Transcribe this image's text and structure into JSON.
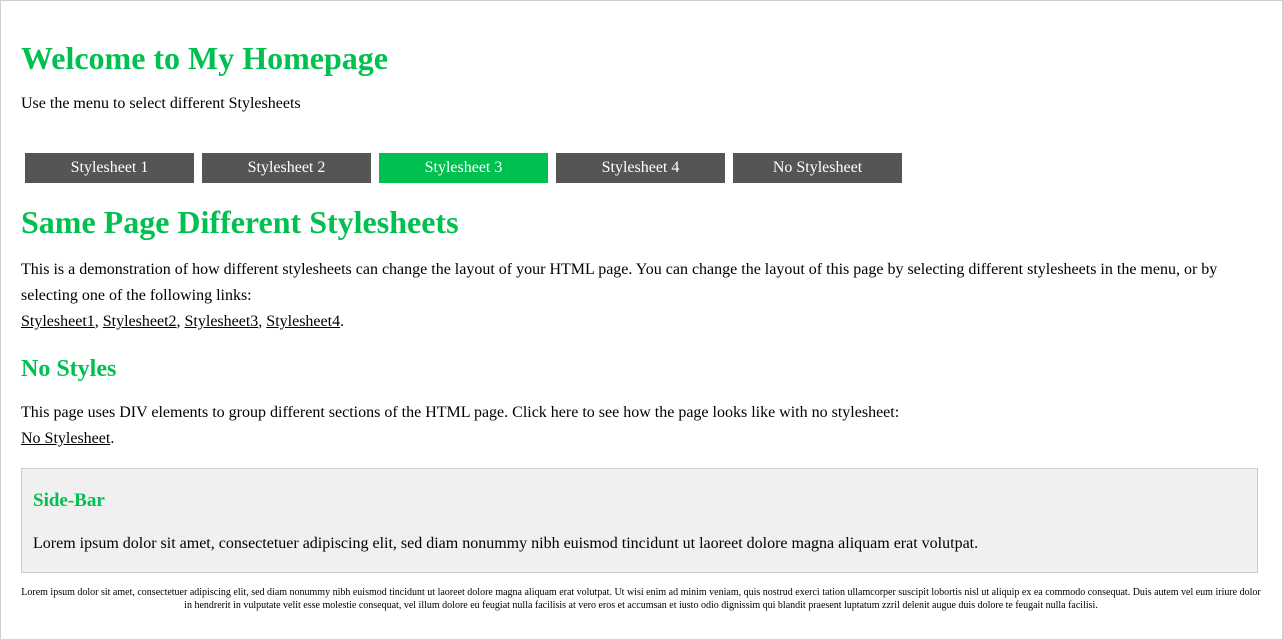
{
  "header": {
    "title": "Welcome to My Homepage",
    "subtitle": "Use the menu to select different Stylesheets"
  },
  "menu": {
    "items": [
      {
        "label": "Stylesheet 1"
      },
      {
        "label": "Stylesheet 2"
      },
      {
        "label": "Stylesheet 3"
      },
      {
        "label": "Stylesheet 4"
      },
      {
        "label": "No Stylesheet"
      }
    ],
    "active_index": 2,
    "active_color": "#00c050",
    "inactive_color": "#555555"
  },
  "main": {
    "title": "Same Page Different Stylesheets",
    "intro_text": "This is a demonstration of how different stylesheets can change the layout of your HTML page. You can change the layout of this page by selecting different stylesheets in the menu, or by selecting one of the following links:",
    "links": [
      "Stylesheet1",
      "Stylesheet2",
      "Stylesheet3",
      "Stylesheet4"
    ],
    "sep": ", ",
    "end": ".",
    "no_styles_title": "No Styles",
    "no_styles_text": "This page uses DIV elements to group different sections of the HTML page. Click here to see how the page looks like with no stylesheet:",
    "no_stylesheet_link": "No Stylesheet",
    "no_stylesheet_end": "."
  },
  "sidebar": {
    "title": "Side-Bar",
    "text": "Lorem ipsum dolor sit amet, consectetuer adipiscing elit, sed diam nonummy nibh euismod tincidunt ut laoreet dolore magna aliquam erat volutpat."
  },
  "footer": {
    "text": "Lorem ipsum dolor sit amet, consectetuer adipiscing elit, sed diam nonummy nibh euismod tincidunt ut laoreet dolore magna aliquam erat volutpat. Ut wisi enim ad minim veniam, quis nostrud exerci tation ullamcorper suscipit lobortis nisl ut aliquip ex ea commodo consequat. Duis autem vel eum iriure dolor in hendrerit in vulputate velit esse molestie consequat, vel illum dolore eu feugiat nulla facilisis at vero eros et accumsan et iusto odio dignissim qui blandit praesent luptatum zzril delenit augue duis dolore te feugait nulla facilisi."
  },
  "colors": {
    "heading": "#00c050",
    "sidebar_bg": "#f0f0f0"
  }
}
